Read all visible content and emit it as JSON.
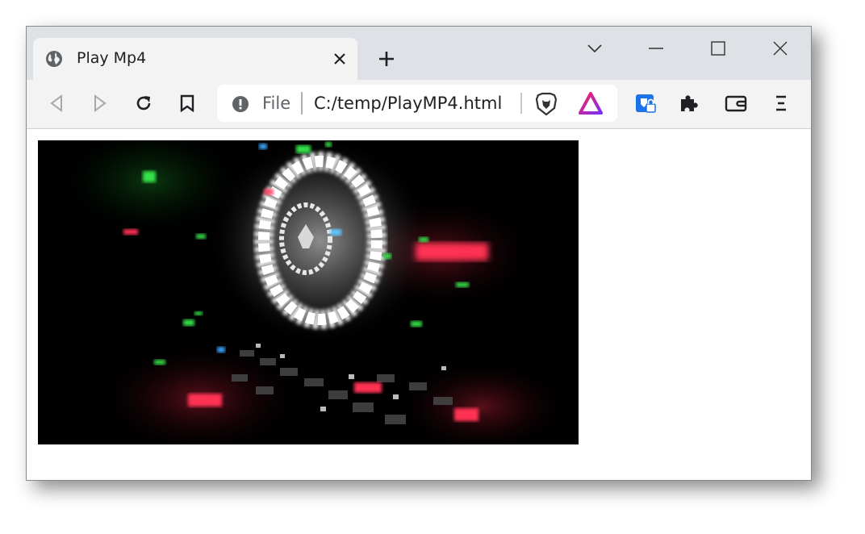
{
  "tab": {
    "title": "Play Mp4",
    "favicon": "globe-icon",
    "close_icon": "close-icon"
  },
  "new_tab_icon": "plus-icon",
  "window_controls": [
    "chevron-down-icon",
    "minimize-icon",
    "maximize-icon",
    "close-icon"
  ],
  "toolbar": {
    "back_icon": "back-arrow-icon",
    "forward_icon": "forward-arrow-icon",
    "reload_icon": "reload-icon",
    "bookmark_icon": "bookmark-icon",
    "extension_icons": [
      "vpn-shield-icon",
      "puzzle-extensions-icon",
      "wallet-icon",
      "menu-icon"
    ]
  },
  "omnibox": {
    "scheme_label": "File",
    "url": "C:/temp/PlayMP4.html",
    "site_info_icon": "info-icon",
    "shields_icon": "brave-lion-icon",
    "rewards_icon": "brave-rewards-triangle-icon"
  },
  "colors": {
    "titlebar": "#dee1e6",
    "toolbar": "#f3f3f3",
    "rewards_gradient": [
      "#ff1f5a",
      "#7b2ff7"
    ],
    "vpn_blue": "#1a73e8"
  },
  "video": {
    "description_icon": "video-player"
  }
}
